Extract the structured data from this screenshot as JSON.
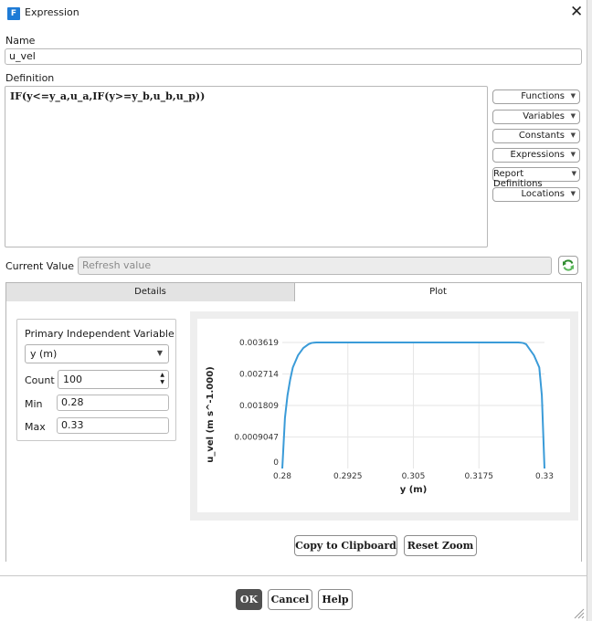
{
  "window": {
    "title": "Expression",
    "app_icon_letter": "F"
  },
  "name_field": {
    "label": "Name",
    "value": "u_vel"
  },
  "definition": {
    "label": "Definition",
    "text": "IF(y<=y_a,u_a,IF(y>=y_b,u_b,u_p))"
  },
  "side_buttons": [
    "Functions",
    "Variables",
    "Constants",
    "Expressions",
    "Report Definitions",
    "Locations"
  ],
  "current_value": {
    "label": "Current Value",
    "placeholder": "Refresh value"
  },
  "tabs": {
    "details": "Details",
    "plot": "Plot"
  },
  "plot_settings": {
    "primary_label": "Primary Independent Variable",
    "variable": "y (m)",
    "count_label": "Count",
    "count": "100",
    "min_label": "Min",
    "min": "0.28",
    "max_label": "Max",
    "max": "0.33"
  },
  "chart_data": {
    "type": "line",
    "xlabel": "y (m)",
    "ylabel": "u_vel (m s^-1.000)",
    "xlim": [
      0.28,
      0.33
    ],
    "ylim": [
      0,
      0.003619
    ],
    "x_ticks": [
      "0.28",
      "0.2925",
      "0.305",
      "0.3175",
      "0.33"
    ],
    "y_ticks": [
      "0",
      "0.0009047",
      "0.001809",
      "0.002714",
      "0.003619"
    ],
    "grid": true,
    "series": [
      {
        "color": "#3a9bd8",
        "x": [
          0.28,
          0.2805,
          0.281,
          0.2815,
          0.282,
          0.283,
          0.284,
          0.285,
          0.2855,
          0.286,
          0.2865,
          0.287,
          0.325,
          0.3255,
          0.326,
          0.3265,
          0.327,
          0.328,
          0.329,
          0.3295,
          0.33
        ],
        "y": [
          0,
          0.00145,
          0.0021,
          0.00255,
          0.0029,
          0.00325,
          0.00346,
          0.00357,
          0.0036,
          0.003615,
          0.003619,
          0.003619,
          0.003619,
          0.003615,
          0.0036,
          0.00357,
          0.00346,
          0.00325,
          0.0029,
          0.0021,
          0
        ]
      }
    ]
  },
  "plot_buttons": {
    "copy": "Copy to Clipboard",
    "reset": "Reset Zoom"
  },
  "footer": {
    "ok": "OK",
    "cancel": "Cancel",
    "help": "Help"
  }
}
